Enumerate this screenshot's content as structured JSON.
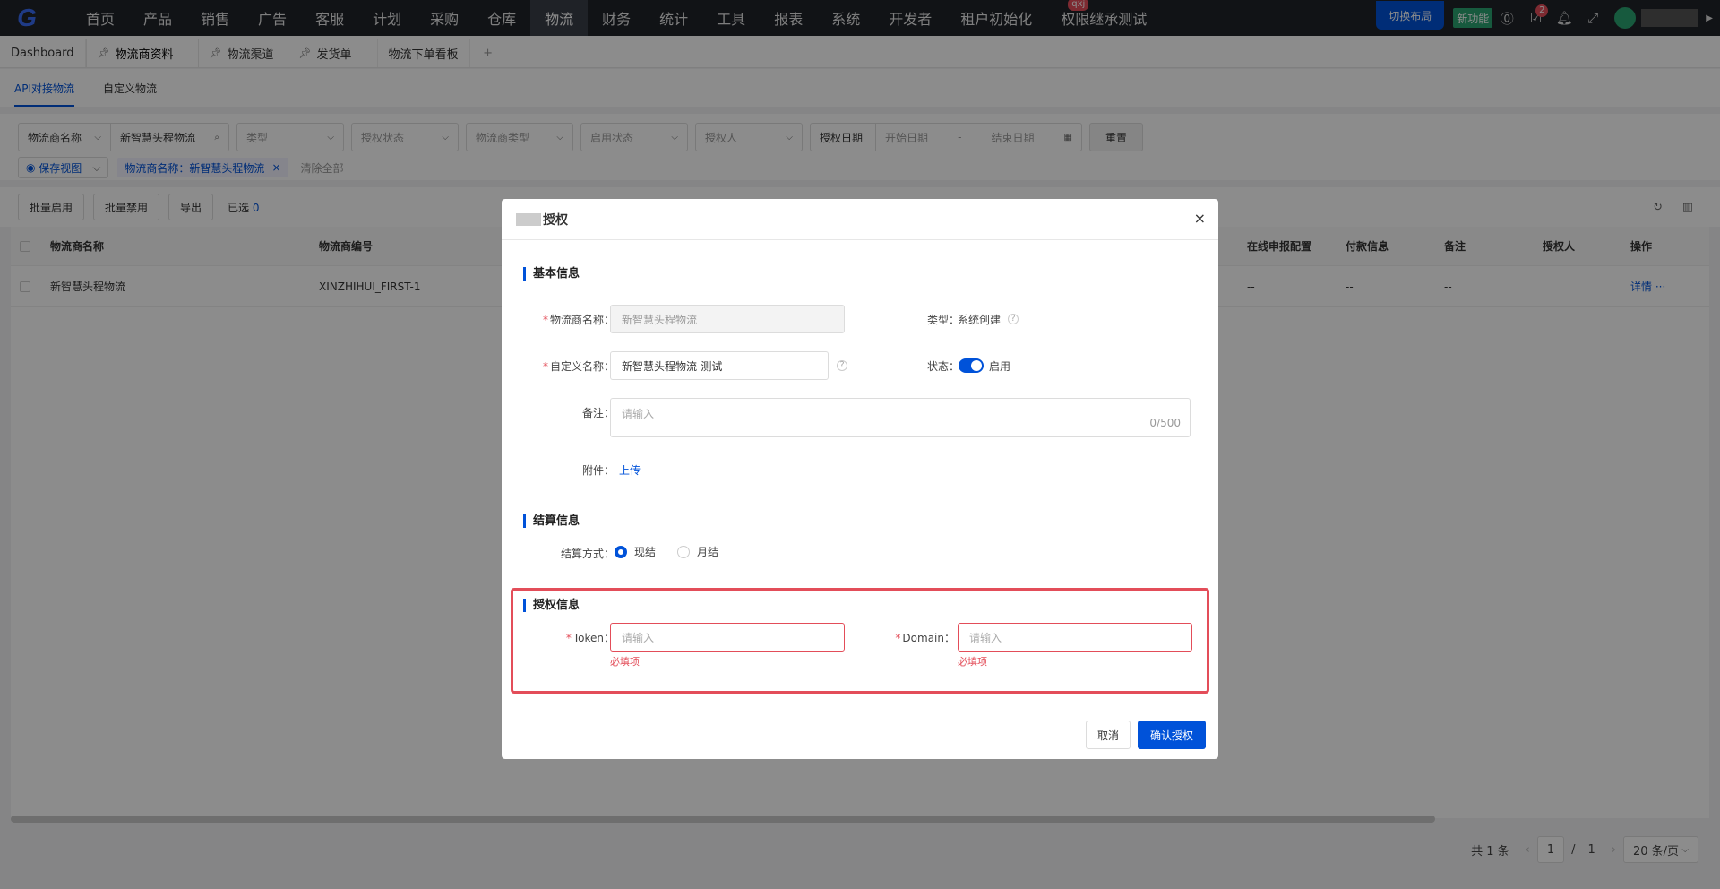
{
  "nav": {
    "items": [
      "首页",
      "产品",
      "销售",
      "广告",
      "客服",
      "计划",
      "采购",
      "仓库",
      "物流",
      "财务",
      "统计",
      "工具",
      "报表",
      "系统",
      "开发者",
      "租户初始化",
      "权限继承测试"
    ],
    "active_index": 8,
    "qxj_badge": "qxj",
    "switch_layout": "切换布局",
    "new_feature": "新功能",
    "task_count": "2"
  },
  "tabs": [
    {
      "label": "Dashboard"
    },
    {
      "label": "物流商资料"
    },
    {
      "label": "物流渠道"
    },
    {
      "label": "发货单"
    },
    {
      "label": "物流下单看板"
    }
  ],
  "subtabs": [
    "API对接物流",
    "自定义物流"
  ],
  "filters": {
    "field_select": "物流商名称",
    "search_value": "新智慧头程物流",
    "type": "类型",
    "auth_status": "授权状态",
    "provider_type": "物流商类型",
    "enable_status": "启用状态",
    "authorizer": "授权人",
    "auth_date_label": "授权日期",
    "start_date": "开始日期",
    "date_sep": "-",
    "end_date": "结束日期",
    "reset": "重置",
    "save_view": "保存视图",
    "active_filter": "物流商名称：新智慧头程物流",
    "clear_all": "清除全部"
  },
  "toolbar": {
    "batch_enable": "批量启用",
    "batch_disable": "批量禁用",
    "export": "导出",
    "selected_label": "已选",
    "selected_count": "0"
  },
  "table": {
    "headers": [
      "物流商名称",
      "物流商编号",
      "在线申报配置",
      "付款信息",
      "备注",
      "授权人",
      "操作"
    ],
    "rows": [
      {
        "name": "新智慧头程物流",
        "code": "XINZHIHUI_FIRST-1",
        "online": "--",
        "payment": "--",
        "remark": "--",
        "action": "详情",
        "more": "···"
      }
    ]
  },
  "pager": {
    "total": "共 1 条",
    "page": "1",
    "sep": "/",
    "pages": "1",
    "page_size": "20 条/页"
  },
  "dialog": {
    "title": "授权",
    "basic_section": "基本信息",
    "provider_name_label": "物流商名称：",
    "provider_name_value": "新智慧头程物流",
    "type_label": "类型：",
    "type_value": "系统创建",
    "custom_name_label": "自定义名称：",
    "custom_name_value": "新智慧头程物流-测试",
    "status_label": "状态：",
    "status_value": "启用",
    "remark_label": "备注：",
    "remark_placeholder": "请输入",
    "remark_counter": "0/500",
    "attachment_label": "附件：",
    "upload": "上传",
    "settle_section": "结算信息",
    "settle_label": "结算方式：",
    "settle_options": [
      "现结",
      "月结"
    ],
    "auth_section": "授权信息",
    "token_label": "Token：",
    "token_placeholder": "请输入",
    "domain_label": "Domain：",
    "domain_placeholder": "请输入",
    "required_msg": "必填项",
    "cancel": "取消",
    "confirm": "确认授权"
  }
}
